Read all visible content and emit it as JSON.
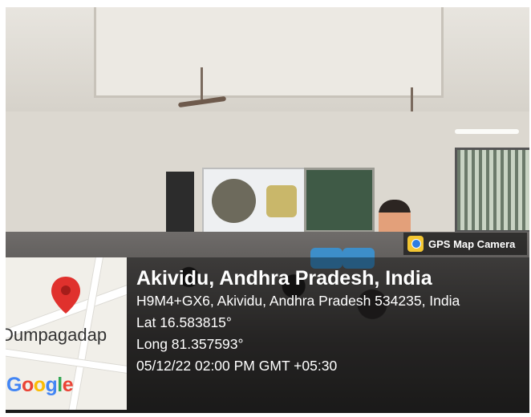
{
  "badge": {
    "icon": "gps-camera-icon",
    "label": "GPS Map Camera"
  },
  "location": {
    "title": "Akividu, Andhra Pradesh, India",
    "address": "H9M4+GX6, Akividu, Andhra Pradesh 534235, India",
    "latitude": "Lat 16.583815°",
    "longitude": "Long 81.357593°",
    "datetime": "05/12/22 02:00 PM GMT +05:30"
  },
  "map": {
    "place_label": "Dumpagadap",
    "provider": "Google",
    "pin_color": "#e0312d"
  }
}
